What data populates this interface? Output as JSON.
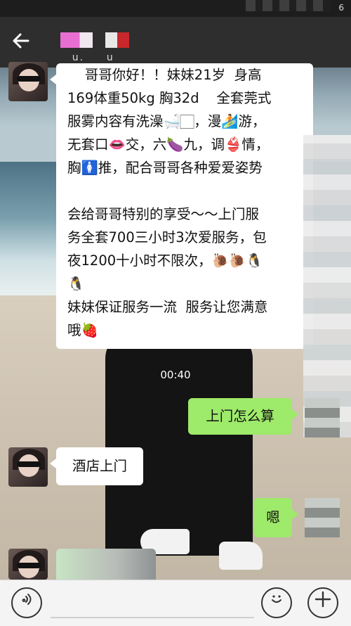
{
  "statusbar": {
    "number": "6"
  },
  "navbar": {
    "back_icon": "arrow-left-icon",
    "title_fragment": " u.    u"
  },
  "messages": {
    "incoming_1": {
      "lines": [
        "    哥哥你好！！妹妹21岁  身高",
        "169体重50kg 胸32d    全套莞式",
        "服雾内容有洗澡🛁🏻，漫🏄游，",
        "无套口👄交，六🍆九，调👙情，",
        "胸🚺推，配合哥哥各种爱爱姿势",
        "",
        "会给哥哥特别的享受～～上门服",
        "务全套700三小时3次爱服务，包",
        "夜1200十小时不限次，🐌🐌🐧",
        "🐧",
        "妹妹保证服务一流  服务让您满意",
        "哦🍓"
      ]
    },
    "timestamp": "00:40",
    "outgoing_1": "上门怎么算",
    "incoming_2": "酒店上门",
    "outgoing_2": "嗯"
  },
  "inputbar": {
    "voice_icon": "voice-icon",
    "emoji_icon": "emoji-icon",
    "plus_icon": "plus-icon"
  }
}
